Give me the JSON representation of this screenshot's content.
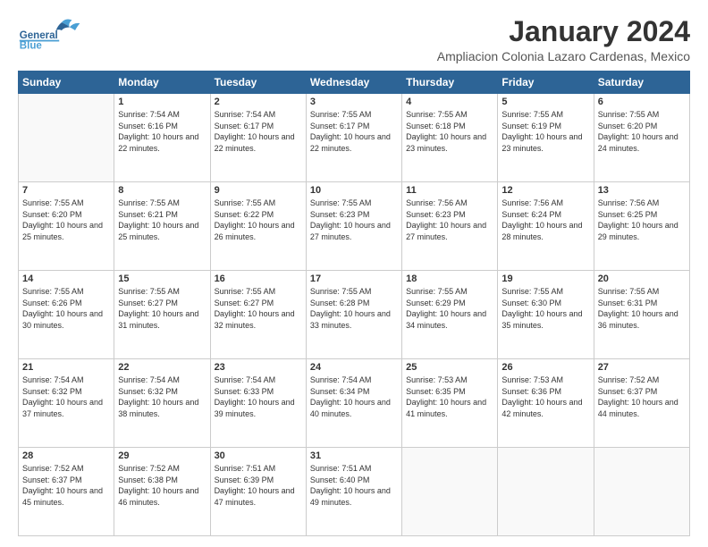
{
  "header": {
    "logo_general": "General",
    "logo_blue": "Blue",
    "month_title": "January 2024",
    "subtitle": "Ampliacion Colonia Lazaro Cardenas, Mexico"
  },
  "days_of_week": [
    "Sunday",
    "Monday",
    "Tuesday",
    "Wednesday",
    "Thursday",
    "Friday",
    "Saturday"
  ],
  "weeks": [
    [
      {
        "day": "",
        "sunrise": "",
        "sunset": "",
        "daylight": ""
      },
      {
        "day": "1",
        "sunrise": "Sunrise: 7:54 AM",
        "sunset": "Sunset: 6:16 PM",
        "daylight": "Daylight: 10 hours and 22 minutes."
      },
      {
        "day": "2",
        "sunrise": "Sunrise: 7:54 AM",
        "sunset": "Sunset: 6:17 PM",
        "daylight": "Daylight: 10 hours and 22 minutes."
      },
      {
        "day": "3",
        "sunrise": "Sunrise: 7:55 AM",
        "sunset": "Sunset: 6:17 PM",
        "daylight": "Daylight: 10 hours and 22 minutes."
      },
      {
        "day": "4",
        "sunrise": "Sunrise: 7:55 AM",
        "sunset": "Sunset: 6:18 PM",
        "daylight": "Daylight: 10 hours and 23 minutes."
      },
      {
        "day": "5",
        "sunrise": "Sunrise: 7:55 AM",
        "sunset": "Sunset: 6:19 PM",
        "daylight": "Daylight: 10 hours and 23 minutes."
      },
      {
        "day": "6",
        "sunrise": "Sunrise: 7:55 AM",
        "sunset": "Sunset: 6:20 PM",
        "daylight": "Daylight: 10 hours and 24 minutes."
      }
    ],
    [
      {
        "day": "7",
        "sunrise": "Sunrise: 7:55 AM",
        "sunset": "Sunset: 6:20 PM",
        "daylight": "Daylight: 10 hours and 25 minutes."
      },
      {
        "day": "8",
        "sunrise": "Sunrise: 7:55 AM",
        "sunset": "Sunset: 6:21 PM",
        "daylight": "Daylight: 10 hours and 25 minutes."
      },
      {
        "day": "9",
        "sunrise": "Sunrise: 7:55 AM",
        "sunset": "Sunset: 6:22 PM",
        "daylight": "Daylight: 10 hours and 26 minutes."
      },
      {
        "day": "10",
        "sunrise": "Sunrise: 7:55 AM",
        "sunset": "Sunset: 6:23 PM",
        "daylight": "Daylight: 10 hours and 27 minutes."
      },
      {
        "day": "11",
        "sunrise": "Sunrise: 7:56 AM",
        "sunset": "Sunset: 6:23 PM",
        "daylight": "Daylight: 10 hours and 27 minutes."
      },
      {
        "day": "12",
        "sunrise": "Sunrise: 7:56 AM",
        "sunset": "Sunset: 6:24 PM",
        "daylight": "Daylight: 10 hours and 28 minutes."
      },
      {
        "day": "13",
        "sunrise": "Sunrise: 7:56 AM",
        "sunset": "Sunset: 6:25 PM",
        "daylight": "Daylight: 10 hours and 29 minutes."
      }
    ],
    [
      {
        "day": "14",
        "sunrise": "Sunrise: 7:55 AM",
        "sunset": "Sunset: 6:26 PM",
        "daylight": "Daylight: 10 hours and 30 minutes."
      },
      {
        "day": "15",
        "sunrise": "Sunrise: 7:55 AM",
        "sunset": "Sunset: 6:27 PM",
        "daylight": "Daylight: 10 hours and 31 minutes."
      },
      {
        "day": "16",
        "sunrise": "Sunrise: 7:55 AM",
        "sunset": "Sunset: 6:27 PM",
        "daylight": "Daylight: 10 hours and 32 minutes."
      },
      {
        "day": "17",
        "sunrise": "Sunrise: 7:55 AM",
        "sunset": "Sunset: 6:28 PM",
        "daylight": "Daylight: 10 hours and 33 minutes."
      },
      {
        "day": "18",
        "sunrise": "Sunrise: 7:55 AM",
        "sunset": "Sunset: 6:29 PM",
        "daylight": "Daylight: 10 hours and 34 minutes."
      },
      {
        "day": "19",
        "sunrise": "Sunrise: 7:55 AM",
        "sunset": "Sunset: 6:30 PM",
        "daylight": "Daylight: 10 hours and 35 minutes."
      },
      {
        "day": "20",
        "sunrise": "Sunrise: 7:55 AM",
        "sunset": "Sunset: 6:31 PM",
        "daylight": "Daylight: 10 hours and 36 minutes."
      }
    ],
    [
      {
        "day": "21",
        "sunrise": "Sunrise: 7:54 AM",
        "sunset": "Sunset: 6:32 PM",
        "daylight": "Daylight: 10 hours and 37 minutes."
      },
      {
        "day": "22",
        "sunrise": "Sunrise: 7:54 AM",
        "sunset": "Sunset: 6:32 PM",
        "daylight": "Daylight: 10 hours and 38 minutes."
      },
      {
        "day": "23",
        "sunrise": "Sunrise: 7:54 AM",
        "sunset": "Sunset: 6:33 PM",
        "daylight": "Daylight: 10 hours and 39 minutes."
      },
      {
        "day": "24",
        "sunrise": "Sunrise: 7:54 AM",
        "sunset": "Sunset: 6:34 PM",
        "daylight": "Daylight: 10 hours and 40 minutes."
      },
      {
        "day": "25",
        "sunrise": "Sunrise: 7:53 AM",
        "sunset": "Sunset: 6:35 PM",
        "daylight": "Daylight: 10 hours and 41 minutes."
      },
      {
        "day": "26",
        "sunrise": "Sunrise: 7:53 AM",
        "sunset": "Sunset: 6:36 PM",
        "daylight": "Daylight: 10 hours and 42 minutes."
      },
      {
        "day": "27",
        "sunrise": "Sunrise: 7:52 AM",
        "sunset": "Sunset: 6:37 PM",
        "daylight": "Daylight: 10 hours and 44 minutes."
      }
    ],
    [
      {
        "day": "28",
        "sunrise": "Sunrise: 7:52 AM",
        "sunset": "Sunset: 6:37 PM",
        "daylight": "Daylight: 10 hours and 45 minutes."
      },
      {
        "day": "29",
        "sunrise": "Sunrise: 7:52 AM",
        "sunset": "Sunset: 6:38 PM",
        "daylight": "Daylight: 10 hours and 46 minutes."
      },
      {
        "day": "30",
        "sunrise": "Sunrise: 7:51 AM",
        "sunset": "Sunset: 6:39 PM",
        "daylight": "Daylight: 10 hours and 47 minutes."
      },
      {
        "day": "31",
        "sunrise": "Sunrise: 7:51 AM",
        "sunset": "Sunset: 6:40 PM",
        "daylight": "Daylight: 10 hours and 49 minutes."
      },
      {
        "day": "",
        "sunrise": "",
        "sunset": "",
        "daylight": ""
      },
      {
        "day": "",
        "sunrise": "",
        "sunset": "",
        "daylight": ""
      },
      {
        "day": "",
        "sunrise": "",
        "sunset": "",
        "daylight": ""
      }
    ]
  ],
  "colors": {
    "header_bg": "#2d6496",
    "header_text": "#ffffff",
    "logo_blue": "#2d6496",
    "logo_light": "#4a9fd4"
  }
}
